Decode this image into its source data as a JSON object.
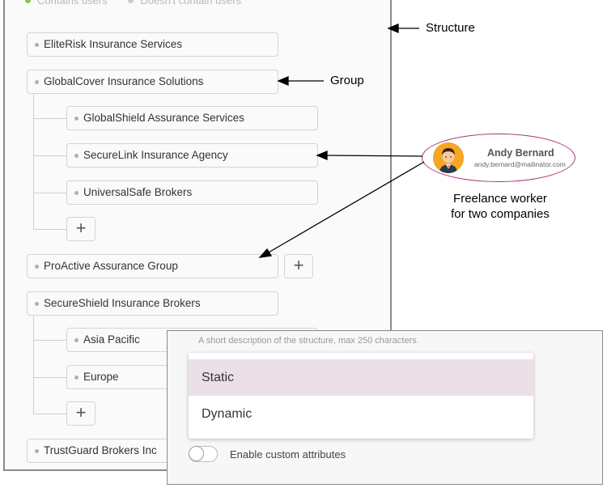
{
  "legend": {
    "contains_users": "Contains users",
    "no_users": "Doesn't contain users",
    "contains_color": "#8bc34a",
    "no_users_color": "#cccccc"
  },
  "tree": {
    "elite_risk": "EliteRisk Insurance Services",
    "global_cover": "GlobalCover Insurance Solutions",
    "global_shield": "GlobalShield Assurance Services",
    "secure_link": "SecureLink Insurance Agency",
    "universal_safe": "UniversalSafe Brokers",
    "proactive": "ProActive Assurance Group",
    "secure_shield": "SecureShield Insurance Brokers",
    "asia_pacific": "Asia Pacific",
    "europe": "Europe",
    "trust_guard": "TrustGuard Brokers Inc"
  },
  "icons": {
    "add": "+",
    "add_icon_name": "plus-icon"
  },
  "annotations": {
    "structure": "Structure",
    "group": "Group"
  },
  "worker": {
    "name": "Andy Bernard",
    "email": "andy.bernard@mailinator.com",
    "note_line1": "Freelance worker",
    "note_line2": "for two companies",
    "outline_color": "#a8327a"
  },
  "overlay": {
    "description_hint": "A short description of the structure, max 250 characters.",
    "options": [
      "Static",
      "Dynamic"
    ],
    "selected": "Static",
    "selected_color": "#ece0e8",
    "toggle_label": "Enable custom attributes"
  }
}
